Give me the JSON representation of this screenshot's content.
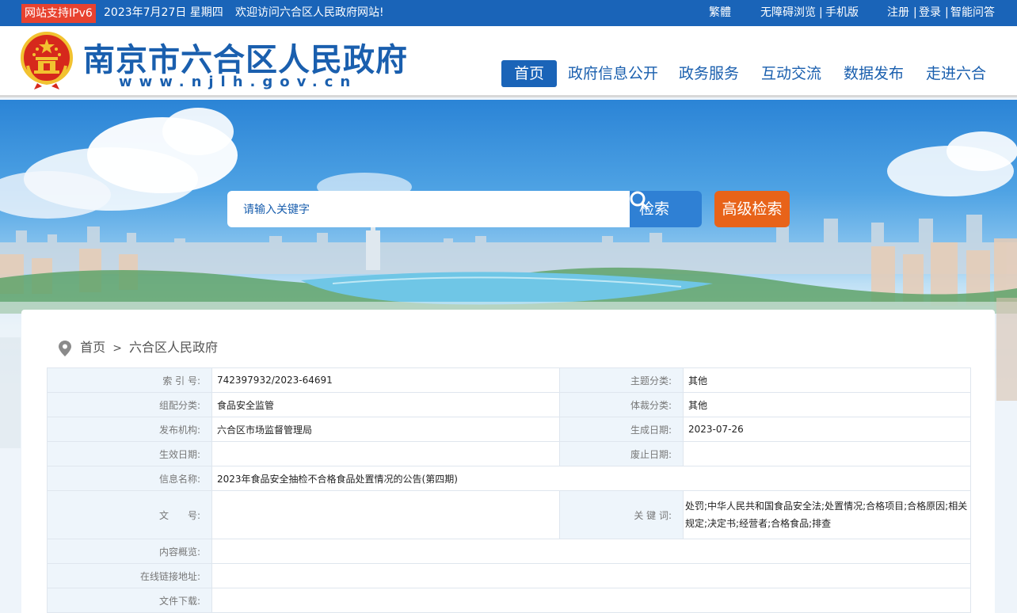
{
  "topbar": {
    "ipv6_badge": "网站支持IPv6",
    "date": "2023年7月27日 星期四",
    "welcome": "欢迎访问六合区人民政府网站!",
    "traditional": "繁體",
    "accessible": "无障碍浏览",
    "mobile": "手机版",
    "register": "注册",
    "login": "登录",
    "smart_qa": "智能问答",
    "separator": "|"
  },
  "header": {
    "site_name": "南京市六合区人民政府",
    "site_url": "www.njlh.gov.cn",
    "nav": [
      "首页",
      "政府信息公开",
      "政务服务",
      "互动交流",
      "数据发布",
      "走进六合"
    ]
  },
  "search": {
    "placeholder": "请输入关键字",
    "search_label": "检索",
    "advanced_label": "高级检索"
  },
  "breadcrumb": {
    "home": "首页",
    "separator": ">",
    "current": "六合区人民政府"
  },
  "info": {
    "index_label": "索 引 号:",
    "index_value": "742397932/2023-64691",
    "topic_label": "主题分类:",
    "topic_value": "其他",
    "category_label": "组配分类:",
    "category_value": "食品安全监管",
    "genre_label": "体裁分类:",
    "genre_value": "其他",
    "publisher_label": "发布机构:",
    "publisher_value": "六合区市场监督管理局",
    "created_label": "生成日期:",
    "created_value": "2023-07-26",
    "effective_label": "生效日期:",
    "effective_value": "",
    "expiry_label": "废止日期:",
    "expiry_value": "",
    "title_label": "信息名称:",
    "title_value": "2023年食品安全抽检不合格食品处置情况的公告(第四期)",
    "docno_label": "文　　号:",
    "docno_value": "",
    "keywords_label": "关 键 词:",
    "keywords_value": "处罚;中华人民共和国食品安全法;处置情况;合格项目;合格原因;相关规定;决定书;经营者;合格食品;排查",
    "summary_label": "内容概览:",
    "summary_value": "",
    "link_label": "在线链接地址:",
    "link_value": "",
    "download_label": "文件下载:",
    "download_value": ""
  },
  "colors": {
    "brand_blue": "#1a64b8",
    "title_blue": "#1a5fae",
    "ipv6_red": "#e8422f",
    "advanced_orange": "#e86319",
    "label_bg": "#eef5fb"
  }
}
